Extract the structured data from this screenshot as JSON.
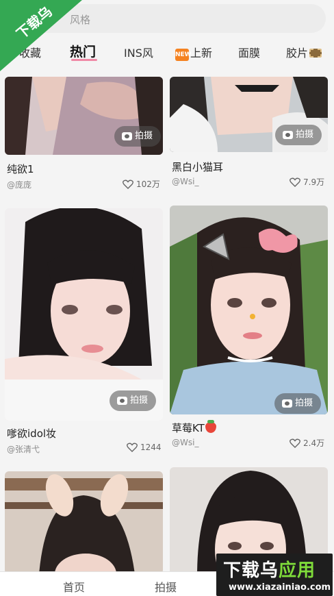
{
  "search": {
    "placeholder": "风格"
  },
  "tabs": [
    {
      "label": "收藏"
    },
    {
      "label": "热门",
      "active": true
    },
    {
      "label": "INS风"
    },
    {
      "label": "上新",
      "badge": "NEW"
    },
    {
      "label": "面膜"
    },
    {
      "label": "胶片"
    }
  ],
  "feed": {
    "shoot_label": "拍摄",
    "cards": [
      {
        "title": "纯欲1",
        "author": "@庞庞",
        "likes": "102万"
      },
      {
        "title": "黑白小猫耳",
        "author": "@Wsi_",
        "likes": "7.9万"
      },
      {
        "title": "嗲欲idol妆",
        "author": "@张清弋",
        "likes": "1244"
      },
      {
        "title": "草莓KT",
        "author": "@Wsi_",
        "likes": "2.4万"
      }
    ]
  },
  "bottom_nav": [
    {
      "label": "首页"
    },
    {
      "label": "拍摄"
    }
  ],
  "watermark": {
    "corner_text": "下载乌",
    "brand_prefix": "下载乌",
    "brand_suffix": "应用",
    "url": "www.xiazainiao.com"
  },
  "colors": {
    "accent_underline": "#f08aa6",
    "watermark_green": "#34a853",
    "badge_orange": "#f58220"
  }
}
